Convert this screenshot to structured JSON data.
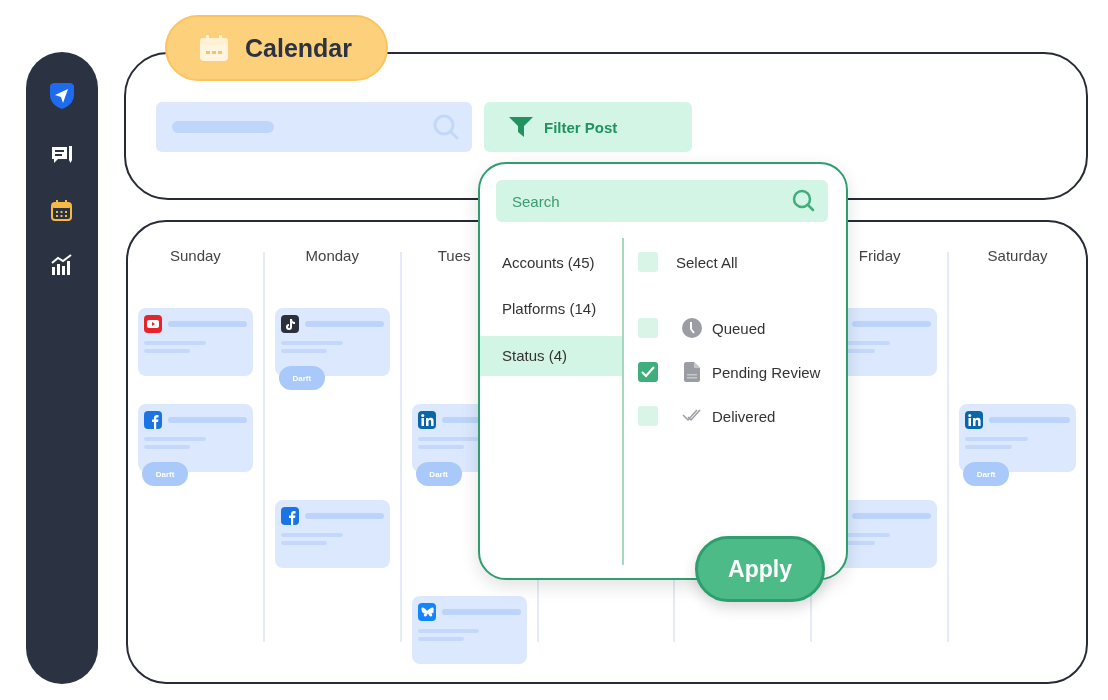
{
  "sidebar": {
    "items": [
      {
        "kind": "compose",
        "selected": false
      },
      {
        "kind": "calendar",
        "selected": true
      },
      {
        "kind": "chart",
        "selected": false
      }
    ]
  },
  "header": {
    "title": "Calendar",
    "filter_button": "Filter Post"
  },
  "calendar": {
    "columns": [
      {
        "day": "Sunday",
        "posts": [
          {
            "kind": "youtube"
          },
          {
            "kind": "facebook",
            "badge": "Darft"
          }
        ]
      },
      {
        "day": "Monday",
        "posts": [
          {
            "kind": "tiktok",
            "badge": "Darft"
          },
          {
            "kind": "empty"
          },
          {
            "kind": "facebook"
          }
        ]
      },
      {
        "day": "Tues",
        "clipped": true,
        "posts": [
          {
            "kind": "empty"
          },
          {
            "kind": "linkedin",
            "badge": "Darft"
          },
          {
            "kind": "empty"
          },
          {
            "kind": "bluesky"
          }
        ]
      },
      {},
      {},
      {
        "day": "Friday",
        "posts": [
          {
            "kind": "plain"
          },
          {
            "kind": "empty"
          },
          {
            "kind": "plain"
          }
        ]
      },
      {
        "day": "Saturday",
        "posts": [
          {
            "kind": "empty"
          },
          {
            "kind": "linkedin",
            "badge": "Darft"
          }
        ]
      }
    ]
  },
  "filter_panel": {
    "search": {
      "placeholder": "Search"
    },
    "categories": [
      {
        "label": "Accounts (45)",
        "selected": false
      },
      {
        "label": "Platforms (14)",
        "selected": false
      },
      {
        "label": "Status (4)",
        "selected": true
      }
    ],
    "options": [
      {
        "kind": "all",
        "label": "Select All",
        "checked": false
      },
      {
        "kind": "clock",
        "label": "Queued",
        "checked": false
      },
      {
        "kind": "file",
        "label": "Pending Review",
        "checked": true
      },
      {
        "kind": "ticks",
        "label": "Delivered",
        "checked": false
      }
    ],
    "apply_button": "Apply"
  }
}
